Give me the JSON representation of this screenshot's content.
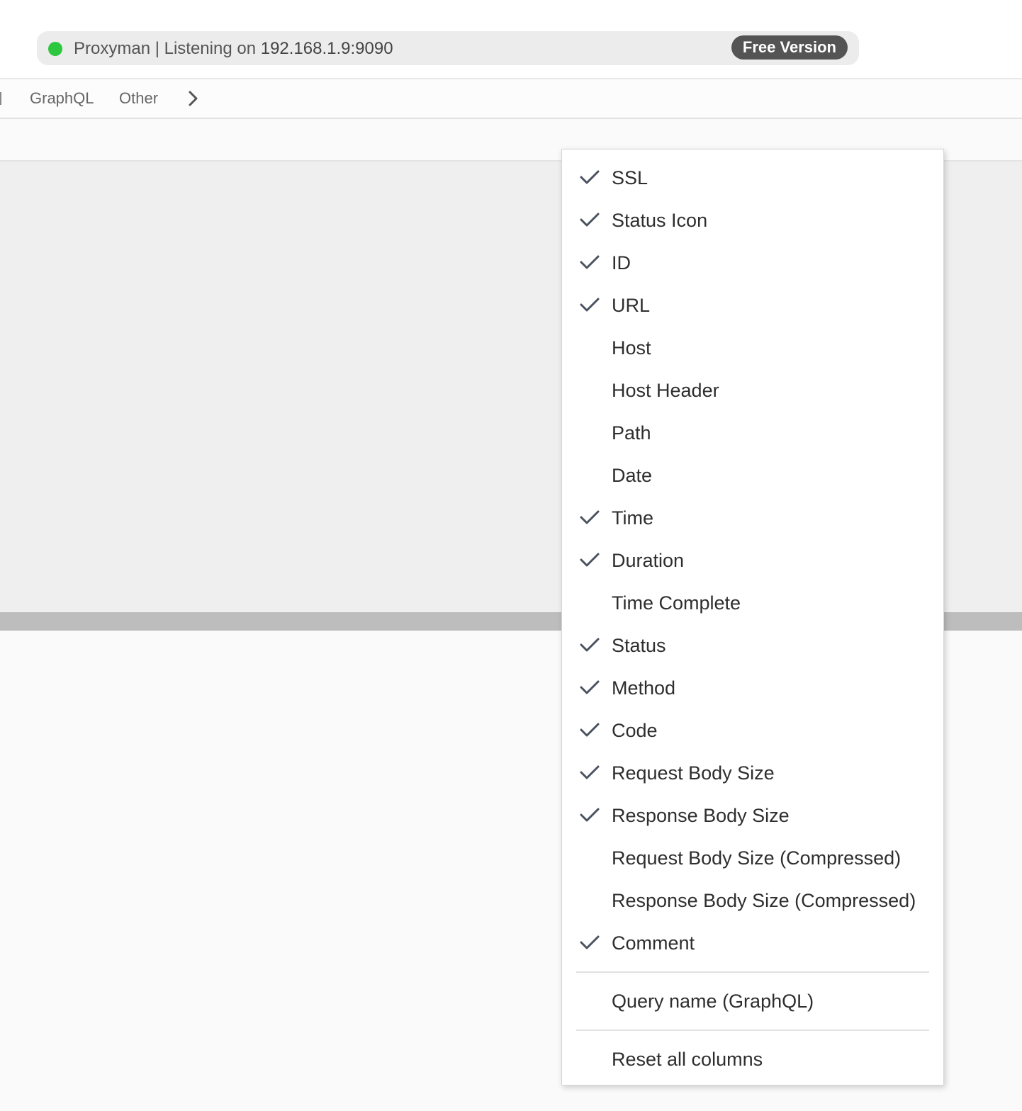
{
  "titlebar": {
    "app_name": "Proxyman | Listening on",
    "ip": "192.168.1.9:9090",
    "badge": "Free Version",
    "status_color": "#2ec840"
  },
  "filters": {
    "tabs": [
      "GraphQL",
      "Other"
    ],
    "more_icon": "chevron-right-icon"
  },
  "column_menu": {
    "check_icon": "checkmark-icon",
    "items": [
      {
        "label": "SSL",
        "checked": true
      },
      {
        "label": "Status Icon",
        "checked": true
      },
      {
        "label": "ID",
        "checked": true
      },
      {
        "label": "URL",
        "checked": true
      },
      {
        "label": "Host",
        "checked": false
      },
      {
        "label": "Host Header",
        "checked": false
      },
      {
        "label": "Path",
        "checked": false
      },
      {
        "label": "Date",
        "checked": false
      },
      {
        "label": "Time",
        "checked": true
      },
      {
        "label": "Duration",
        "checked": true
      },
      {
        "label": "Time Complete",
        "checked": false
      },
      {
        "label": "Status",
        "checked": true
      },
      {
        "label": "Method",
        "checked": true
      },
      {
        "label": "Code",
        "checked": true
      },
      {
        "label": "Request Body Size",
        "checked": true
      },
      {
        "label": "Response Body Size",
        "checked": true
      },
      {
        "label": "Request Body Size (Compressed)",
        "checked": false
      },
      {
        "label": "Response Body Size (Compressed)",
        "checked": false
      },
      {
        "label": "Comment",
        "checked": true
      }
    ],
    "graphql_item": "Query name (GraphQL)",
    "reset_item": "Reset all columns"
  }
}
